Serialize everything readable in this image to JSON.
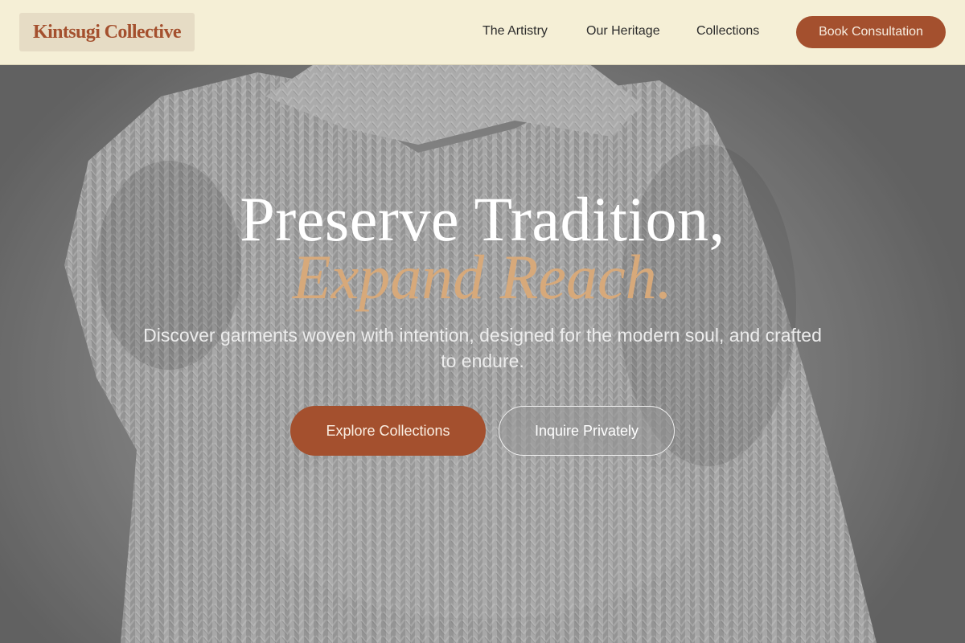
{
  "brand": {
    "name": "Kintsugi Collective"
  },
  "nav": {
    "items": [
      {
        "label": "The Artistry"
      },
      {
        "label": "Our Heritage"
      },
      {
        "label": "Collections"
      }
    ],
    "cta_label": "Book Consultation"
  },
  "hero": {
    "headline_line1": "Preserve Tradition,",
    "headline_line2": "Expand Reach.",
    "subtitle": "Discover garments woven with intention, designed for the modern soul, and crafted to endure.",
    "primary_button": "Explore Collections",
    "secondary_button": "Inquire Privately",
    "background_image": "knitted-sweater-photo"
  },
  "colors": {
    "accent": "#a4502e",
    "nav_background": "#f5efd6",
    "headline_accent": "#d7a97a"
  }
}
